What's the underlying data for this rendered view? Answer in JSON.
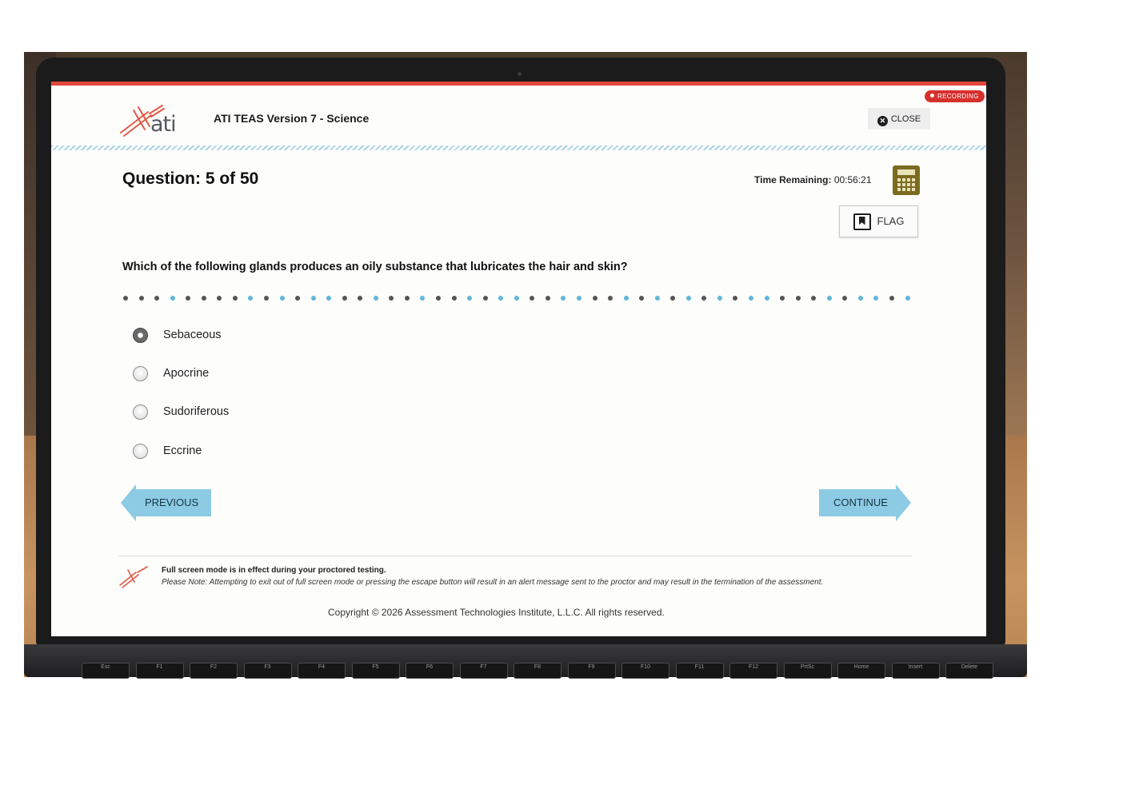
{
  "recording_label": "RECORDING",
  "logo_text": "ati",
  "exam_title": "ATI TEAS Version 7 - Science",
  "close_label": "CLOSE",
  "question_counter": "Question: 5 of 50",
  "time_remaining_label": "Time Remaining:",
  "time_remaining_value": "00:56:21",
  "flag_label": "FLAG",
  "question_text": "Which of the following glands produces an oily substance that lubricates the hair and skin?",
  "options": [
    {
      "label": "Sebaceous",
      "selected": true
    },
    {
      "label": "Apocrine",
      "selected": false
    },
    {
      "label": "Sudoriferous",
      "selected": false
    },
    {
      "label": "Eccrine",
      "selected": false
    }
  ],
  "previous_label": "PREVIOUS",
  "continue_label": "CONTINUE",
  "footer": {
    "fullscreen_note": "Full screen mode is in effect during your proctored testing.",
    "warning": "Please Note: Attempting to exit out of full screen mode or pressing the escape button will result in an alert message sent to the proctor and may result in the termination of the assessment.",
    "copyright": "Copyright © 2026 Assessment Technologies Institute, L.L.C. All rights reserved."
  },
  "keyboard_keys": [
    "Esc",
    "F1",
    "F2",
    "F3",
    "F4",
    "F5",
    "F6",
    "F7",
    "F8",
    "F9",
    "F10",
    "F11",
    "F12",
    "PrtSc",
    "Home",
    "Insert",
    "Delete"
  ],
  "colors": {
    "accent_red": "#e2483b",
    "nav_blue": "#8ccbe3",
    "calculator": "#7a6b20",
    "dot_blue": "#5fb6d9",
    "dot_dark": "#555555"
  }
}
